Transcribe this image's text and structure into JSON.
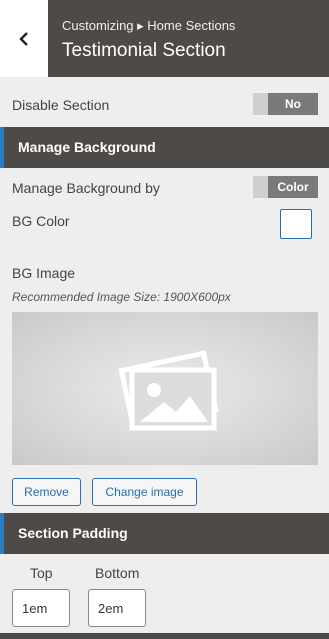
{
  "header": {
    "breadcrumb": "Customizing ▸ Home Sections",
    "title": "Testimonial Section",
    "back_icon": "chevron-left-icon"
  },
  "disable_section": {
    "label": "Disable Section",
    "value": "No"
  },
  "manage_background_section": {
    "label": "Manage Background"
  },
  "manage_background_by": {
    "label": "Manage Background by",
    "value": "Color"
  },
  "bg_color": {
    "label": "BG Color",
    "value": "#ffffff"
  },
  "bg_image": {
    "label": "BG Image",
    "hint": "Recommended Image Size: 1900X600px",
    "placeholder_icon": "image-placeholder-icon",
    "remove_label": "Remove",
    "change_label": "Change image"
  },
  "section_padding": {
    "label": "Section Padding",
    "top_label": "Top",
    "top_value": "1em",
    "bottom_label": "Bottom",
    "bottom_value": "2em"
  },
  "colors": {
    "dark_bar": "#4e4a47",
    "accent": "#2a7ec3",
    "link": "#2a6fb0"
  }
}
